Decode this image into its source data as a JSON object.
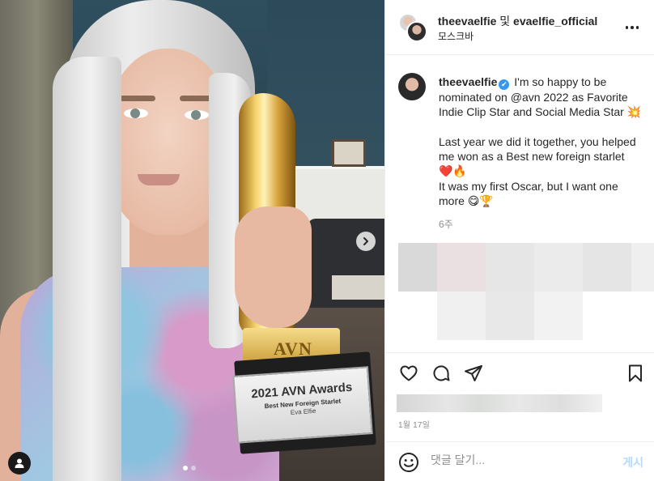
{
  "photo": {
    "trophy_label": "AVN",
    "plaque_title": "2021 AVN Awards",
    "plaque_category": "Best New Foreign Starlet",
    "plaque_name": "Eva Elfie",
    "carousel_index": 1,
    "carousel_count": 2
  },
  "header": {
    "user1": "theevaelfie",
    "conjunction": "및",
    "user2": "evaelfie_official",
    "location": "모스크바"
  },
  "caption": {
    "username": "theevaelfie",
    "verified_glyph": "✔",
    "line1": "I'm so happy to be nominated on @avn 2022 as Favorite Indie Clip Star and Social Media Star",
    "line1_emoji": "💥",
    "line2": "Last year we did it together, you helped me won as a Best new foreign starlet",
    "line2_emoji": "❤️🔥",
    "line3": "It was my first Oscar, but I want one more",
    "line3_emoji": "😋🏆",
    "time_ago": "6주"
  },
  "footer": {
    "date": "1월 17일",
    "comment_placeholder": "댓글 달기...",
    "post_label": "게시"
  },
  "colors": {
    "verified": "#3897f0",
    "post_button": "#b3dbff",
    "text": "#262626",
    "muted": "#8e8e8e"
  },
  "icons": [
    "chevron-right-icon",
    "user-tag-icon",
    "more-icon",
    "heart-icon",
    "comment-icon",
    "share-icon",
    "bookmark-icon",
    "smile-icon",
    "verified-icon"
  ]
}
